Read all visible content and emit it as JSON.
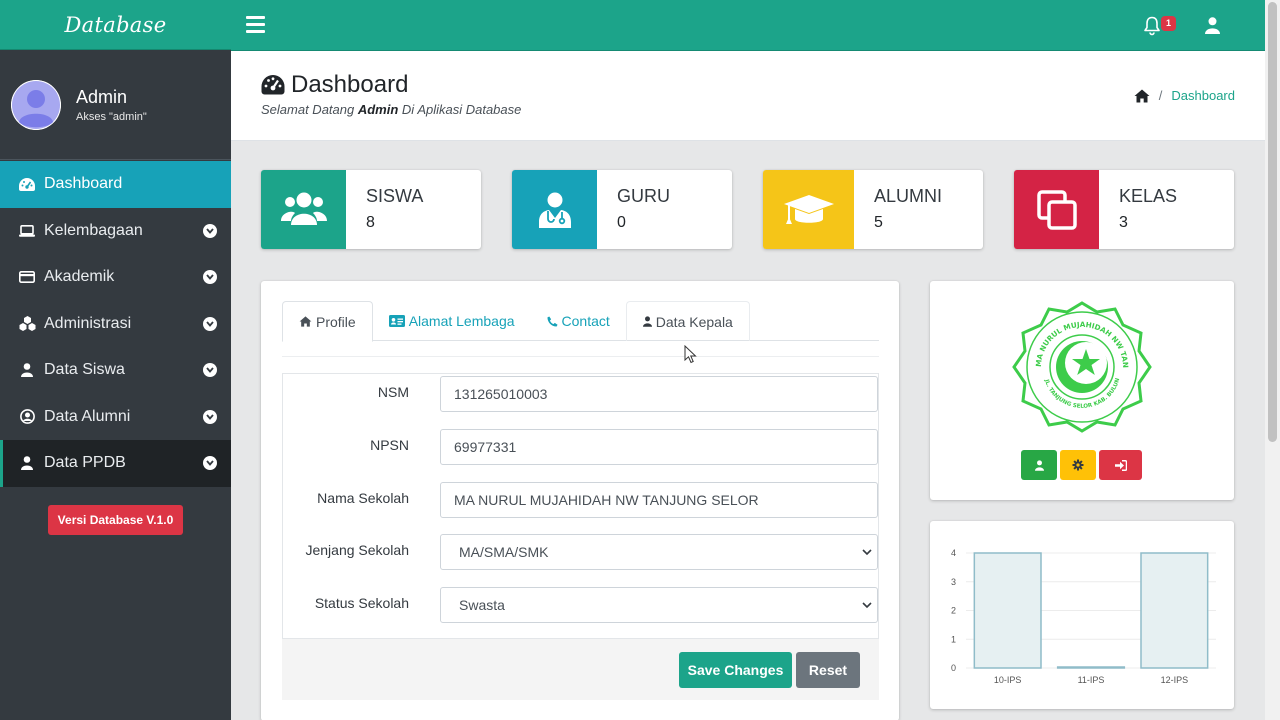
{
  "brand": {
    "title": "Database"
  },
  "user": {
    "name": "Admin",
    "role": "Akses \"admin\""
  },
  "sidebar": {
    "items": [
      {
        "label": "Dashboard",
        "icon": "tachometer-icon"
      },
      {
        "label": "Kelembagaan",
        "icon": "laptop-icon"
      },
      {
        "label": "Akademik",
        "icon": "credit-card-icon"
      },
      {
        "label": "Administrasi",
        "icon": "cubes-icon"
      },
      {
        "label": "Data Siswa",
        "icon": "user-icon"
      },
      {
        "label": "Data Alumni",
        "icon": "user-circle-icon"
      },
      {
        "label": "Data PPDB",
        "icon": "user-icon"
      }
    ],
    "version": "Versi Database V.1.0"
  },
  "topbar": {
    "notification_count": "1"
  },
  "header": {
    "title": "Dashboard",
    "subtitle_before": "Selamat Datang ",
    "subtitle_bold": "Admin",
    "subtitle_after": " Di Aplikasi Database",
    "breadcrumb": "Dashboard"
  },
  "stats": [
    {
      "label": "SISWA",
      "value": "8",
      "color": "#1ca48a",
      "icon": "users-icon"
    },
    {
      "label": "GURU",
      "value": "0",
      "color": "#17a2b8",
      "icon": "user-md-icon"
    },
    {
      "label": "ALUMNI",
      "value": "5",
      "color": "#f5c518",
      "icon": "graduation-cap-icon"
    },
    {
      "label": "KELAS",
      "value": "3",
      "color": "#d42345",
      "icon": "clone-icon"
    }
  ],
  "tabs": [
    {
      "label": "Profile",
      "icon": "home-icon"
    },
    {
      "label": "Alamat Lembaga",
      "icon": "address-card-icon"
    },
    {
      "label": "Contact",
      "icon": "phone-icon"
    },
    {
      "label": "Data Kepala",
      "icon": "user-icon"
    }
  ],
  "form": {
    "nsm": {
      "label": "NSM",
      "value": "131265010003"
    },
    "npsn": {
      "label": "NPSN",
      "value": "69977331"
    },
    "nama": {
      "label": "Nama Sekolah",
      "value": "MA NURUL MUJAHIDAH NW TANJUNG SELOR"
    },
    "jenjang": {
      "label": "Jenjang Sekolah",
      "value": "MA/SMA/SMK"
    },
    "status": {
      "label": "Status Sekolah",
      "value": "Swasta"
    },
    "save_label": "Save Changes",
    "reset_label": "Reset"
  },
  "logo": {
    "top_text": "MA NURUL MUJAHIDAH NW TANJUNG SELOR",
    "bottom_text": "JL. TANJUNG SELOR KAB. BULUNGAN",
    "color": "#3dcc4a"
  },
  "chart_data": {
    "type": "bar",
    "categories": [
      "10-IPS",
      "11-IPS",
      "12-IPS"
    ],
    "values": [
      4,
      0,
      4
    ],
    "ylim": [
      0,
      4
    ],
    "yticks": [
      0,
      1,
      2,
      3,
      4
    ],
    "grid": true,
    "bar_fill": "#e6f0f2",
    "bar_stroke": "#8fbcc9"
  }
}
